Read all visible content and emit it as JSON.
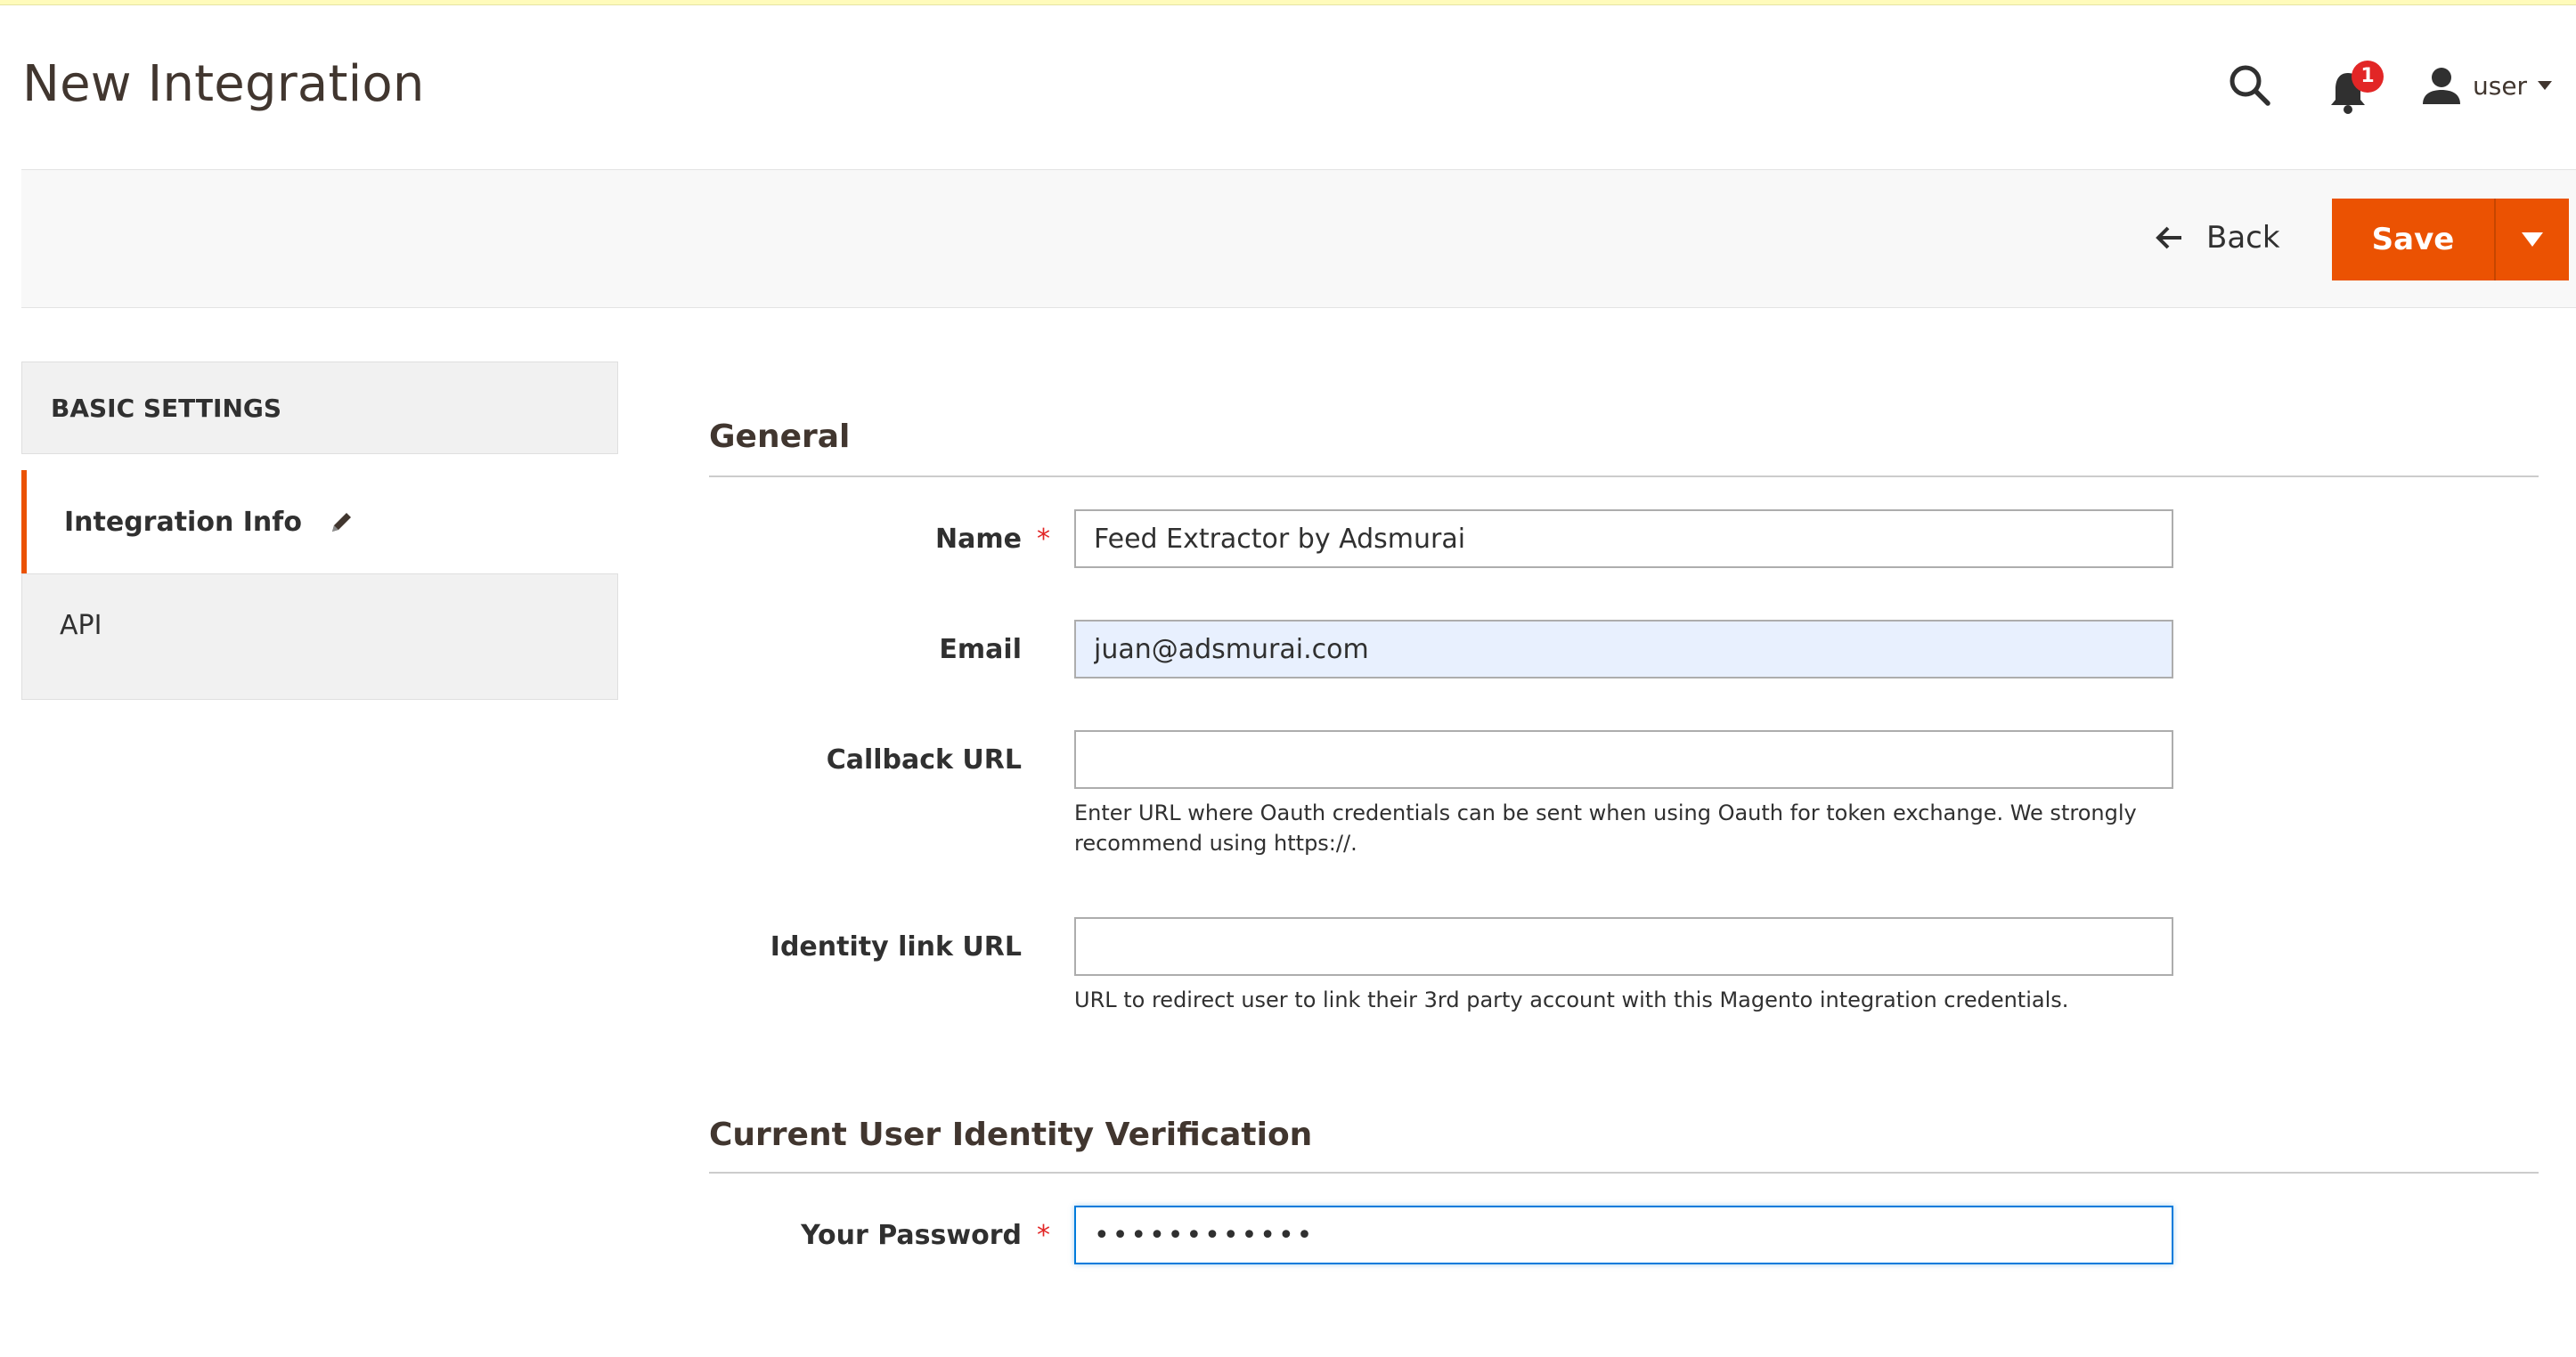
{
  "header": {
    "title": "New Integration",
    "notifications_count": "1",
    "user_name": "user"
  },
  "actions": {
    "back_label": "Back",
    "save_label": "Save"
  },
  "sidebar": {
    "heading": "BASIC SETTINGS",
    "tabs": [
      {
        "label": "Integration Info",
        "active": true
      },
      {
        "label": "API",
        "active": false
      }
    ]
  },
  "general": {
    "title": "General",
    "name_label": "Name",
    "name_value": "Feed Extractor by Adsmurai",
    "email_label": "Email",
    "email_value": "juan@adsmurai.com",
    "callback_label": "Callback URL",
    "callback_value": "",
    "callback_note": "Enter URL where Oauth credentials can be sent when using Oauth for token exchange. We strongly recommend using https://.",
    "identity_label": "Identity link URL",
    "identity_value": "",
    "identity_note": "URL to redirect user to link their 3rd party account with this Magento integration credentials."
  },
  "verification": {
    "title": "Current User Identity Verification",
    "password_label": "Your Password",
    "password_value": "••••••••••••"
  },
  "colors": {
    "accent": "#eb5202",
    "required": "#e22626",
    "focus": "#007bdb",
    "autofill": "#e8f0fe"
  }
}
